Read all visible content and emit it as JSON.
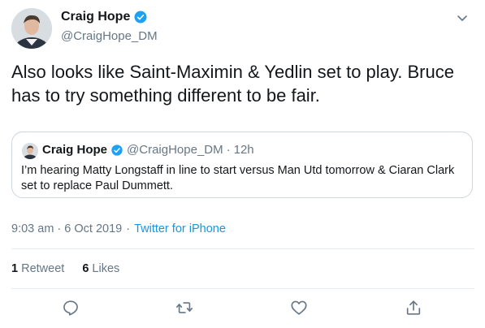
{
  "author": {
    "name": "Craig Hope",
    "handle": "@CraigHope_DM",
    "verified": true
  },
  "tweet": {
    "text": "Also looks like Saint-Maximin & Yedlin set to play. Bruce has to try something different to be fair."
  },
  "quoted_tweet": {
    "name": "Craig Hope",
    "handle": "@CraigHope_DM",
    "separator": "·",
    "time": "12h",
    "text": "I’m hearing Matty Longstaff in line to start versus Man Utd tomorrow & Ciaran Clark set to replace Paul Dummett."
  },
  "meta": {
    "timestamp": "9:03 am · 6 Oct 2019",
    "separator": "·",
    "source": "Twitter for iPhone"
  },
  "stats": {
    "retweets_count": "1",
    "retweets_label": "Retweet",
    "likes_count": "6",
    "likes_label": "Likes"
  },
  "icons": {
    "verified": "verified-badge-icon",
    "more": "chevron-down-icon",
    "reply": "reply-icon",
    "retweet": "retweet-icon",
    "like": "heart-icon",
    "share": "share-icon"
  },
  "colors": {
    "text": "#14171a",
    "secondary": "#657786",
    "link": "#1b95e0",
    "verified": "#1da1f2",
    "border": "#ccd6dd"
  }
}
